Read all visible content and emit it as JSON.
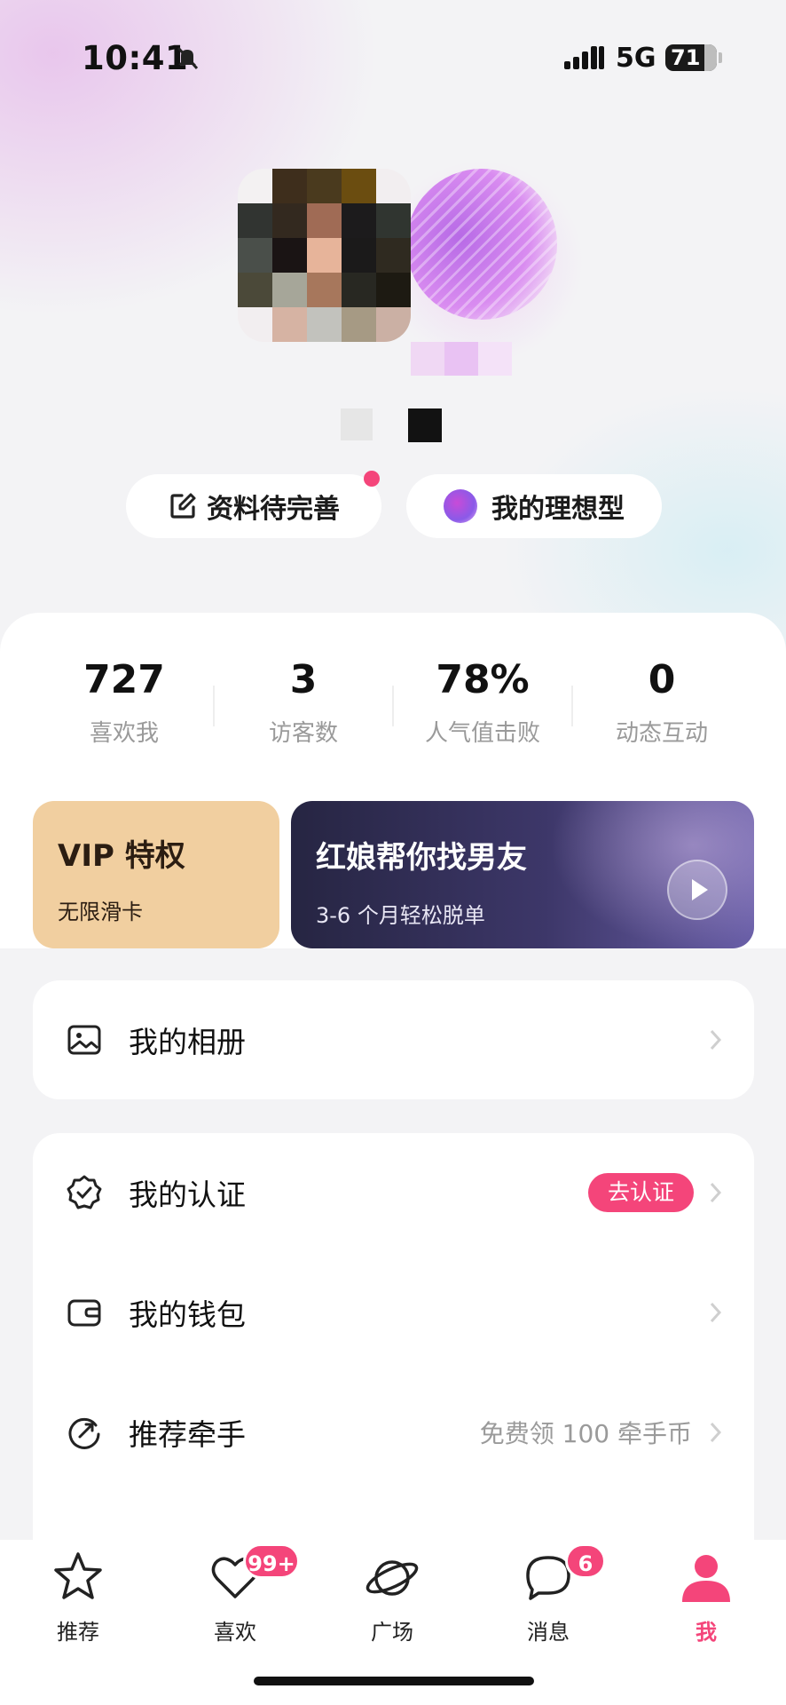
{
  "status_bar": {
    "time": "10:41",
    "network": "5G",
    "battery": "71"
  },
  "profile": {
    "edit_profile_label": "资料待完善",
    "ideal_type_label": "我的理想型"
  },
  "stats": [
    {
      "value": "727",
      "label": "喜欢我"
    },
    {
      "value": "3",
      "label": "访客数"
    },
    {
      "value": "78%",
      "label": "人气值击败"
    },
    {
      "value": "0",
      "label": "动态互动"
    }
  ],
  "promo": {
    "vip_title": "VIP 特权",
    "vip_subtitle": "无限滑卡",
    "matchmaker_title": "红娘帮你找男友",
    "matchmaker_subtitle": "3-6 个月轻松脱单"
  },
  "menu": {
    "album": "我的相册",
    "verification": "我的认证",
    "verification_badge": "去认证",
    "wallet": "我的钱包",
    "referral": "推荐牵手",
    "referral_extra": "免费领 100 牵手币"
  },
  "tabs": [
    {
      "label": "推荐",
      "icon": "star-icon"
    },
    {
      "label": "喜欢",
      "icon": "heart-icon",
      "badge": "99+"
    },
    {
      "label": "广场",
      "icon": "planet-icon"
    },
    {
      "label": "消息",
      "icon": "chat-icon",
      "badge": "6"
    },
    {
      "label": "我",
      "icon": "person-icon",
      "active": true
    }
  ],
  "colors": {
    "accent": "#f4457a",
    "vip": "#f1cfa0",
    "matchmaker": "#262542"
  }
}
